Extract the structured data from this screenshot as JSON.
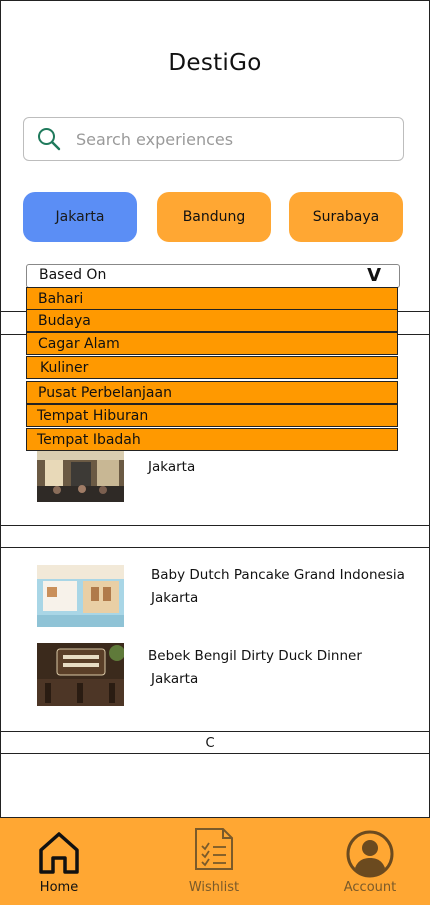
{
  "app": {
    "title": "DestiGo"
  },
  "search": {
    "placeholder": "Search experiences"
  },
  "cities": [
    {
      "label": "Jakarta",
      "selected": true
    },
    {
      "label": "Bandung",
      "selected": false
    },
    {
      "label": "Surabaya",
      "selected": false
    }
  ],
  "filter": {
    "label": "Based On",
    "chevron": "V",
    "options": [
      "Bahari",
      "Budaya",
      "Cagar Alam",
      "Kuliner",
      "Pusat Perbelanjaan",
      "Tempat Hiburan",
      "Tempat Ibadah"
    ]
  },
  "results": [
    {
      "name": "",
      "city": "Jakarta"
    },
    {
      "name": "Baby Dutch Pancake Grand Indonesia",
      "city": "Jakarta"
    },
    {
      "name": "Bebek Bengil Dirty Duck Dinner",
      "city": "Jakarta"
    }
  ],
  "section_footer": {
    "text": "C"
  },
  "bottom_nav": {
    "items": [
      {
        "label": "Home",
        "icon": "home-icon",
        "active": true
      },
      {
        "label": "Wishlist",
        "icon": "checklist-icon",
        "active": false
      },
      {
        "label": "Account",
        "icon": "account-icon",
        "active": false
      }
    ]
  },
  "colors": {
    "accent": "#ffa733",
    "selected_city": "#5b8ef5",
    "dropdown": "#ff9900"
  }
}
